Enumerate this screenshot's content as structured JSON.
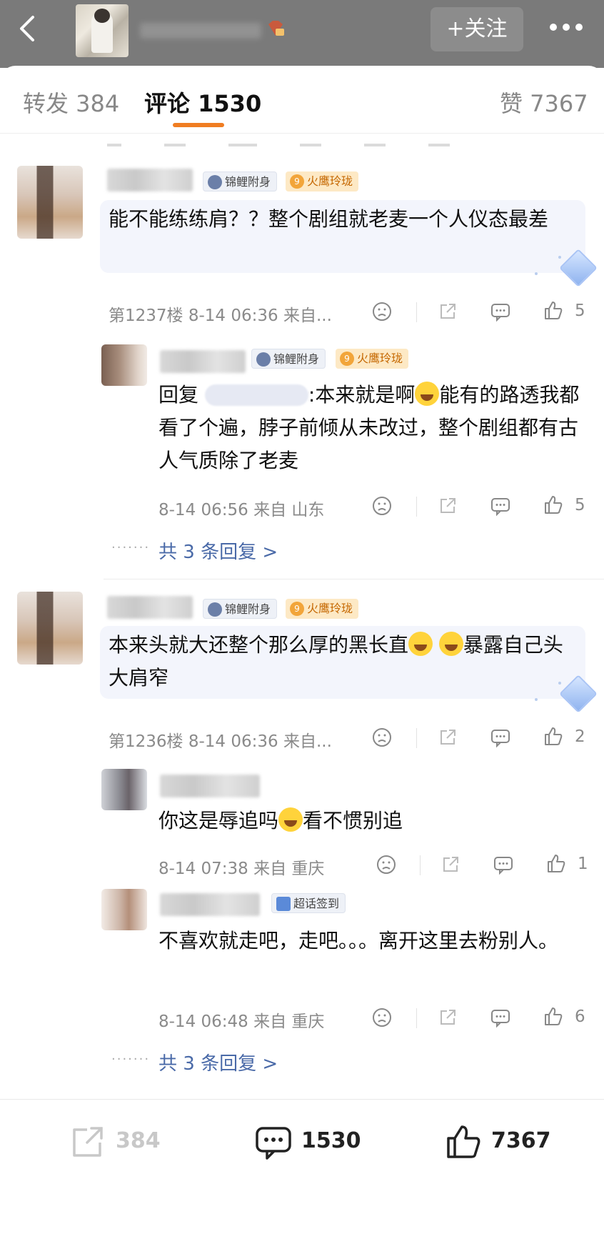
{
  "header": {
    "follow_label": "+关注",
    "icons": [
      "back-arrow-icon",
      "gem-badge-icon",
      "more-icon"
    ]
  },
  "tabs": {
    "repost_label": "转发 384",
    "comment_label": "评论 1530",
    "like_label": "赞 7367"
  },
  "comments": [
    {
      "text": "能不能练练肩？？整个剧组就老麦一个人仪态最差",
      "badges": [
        "锦鲤附身",
        "火鹰玲珑"
      ],
      "badge_level": "9",
      "meta": "第1237楼 8-14 06:36 来自...",
      "likes": "5",
      "reply": {
        "badges": [
          "锦鲤附身",
          "火鹰玲珑"
        ],
        "badge_level": "9",
        "prefix": "回复",
        "text_a": ":本来就是啊",
        "text_b": "能有的路透我都看了个遍，脖子前倾从未改过，整个剧组都有古人气质除了老麦",
        "meta": "8-14 06:56 来自 山东",
        "likes": "5"
      },
      "more_replies": "共 3 条回复 >"
    },
    {
      "text_a": "本来头就大还整个那么厚的黑长直",
      "text_b": "暴露自己头大肩窄",
      "badges": [
        "锦鲤附身",
        "火鹰玲珑"
      ],
      "badge_level": "9",
      "meta": "第1236楼 8-14 06:36 来自...",
      "likes": "2",
      "replies": [
        {
          "text_a": "你这是辱追吗",
          "text_b": "看不惯别追",
          "meta": "8-14 07:38 来自 重庆",
          "likes": "1"
        },
        {
          "badge": "超话签到",
          "text": "不喜欢就走吧，走吧。。。离开这里去粉别人。",
          "meta": "8-14 06:48 来自 重庆",
          "likes": "6"
        }
      ],
      "more_replies": "共 3 条回复 >"
    }
  ],
  "bottom": {
    "repost_count": "384",
    "comment_count": "1530",
    "like_count": "7367"
  },
  "colors": {
    "accent": "#f07d22",
    "link": "#4a6aa8",
    "meta": "#8a8a8a"
  }
}
